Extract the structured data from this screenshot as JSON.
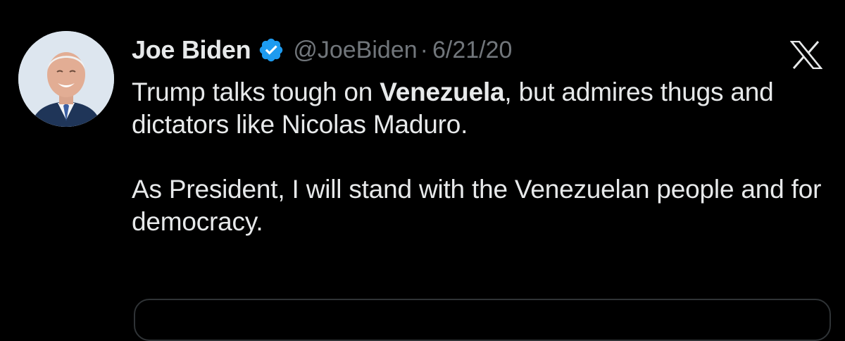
{
  "tweet": {
    "author": {
      "display_name": "Joe Biden",
      "handle": "@JoeBiden",
      "verified_icon": "verified-badge-icon",
      "avatar": "profile-photo"
    },
    "separator": "·",
    "date": "6/21/20",
    "platform_icon": "x-logo-icon",
    "text": {
      "line_a_pre": "Trump talks tough on ",
      "line_a_bold": "Venezuela",
      "line_a_post": ", but admires thugs and dictators like Nicolas Maduro.",
      "paragraph_2": "As President, I will stand with the Venezuelan people and for democracy."
    }
  },
  "colors": {
    "background": "#000000",
    "text_primary": "#e7e9ea",
    "text_secondary": "#71767b",
    "verified_blue": "#1d9bf0",
    "card_border": "#2f3336"
  }
}
